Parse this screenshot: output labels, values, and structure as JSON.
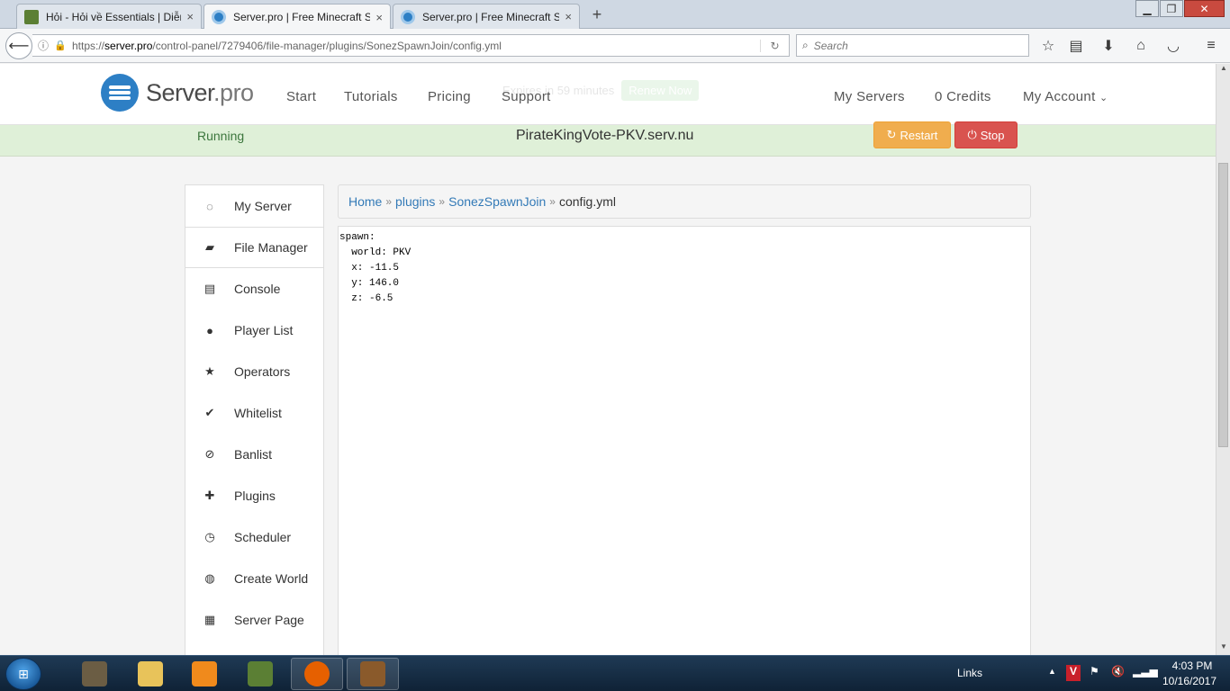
{
  "browser": {
    "tabs": [
      {
        "title": "Hỏi - Hỏi về Essentials | Diễn",
        "close": "×"
      },
      {
        "title": "Server.pro | Free Minecraft Se",
        "close": "×"
      },
      {
        "title": "Server.pro | Free Minecraft Se",
        "close": "×"
      }
    ],
    "new_tab": "+",
    "url_host": "server.pro",
    "url_prefix": "https://",
    "url_path": "/control-panel/7279406/file-manager/plugins/SonezSpawnJoin/config.yml",
    "search_placeholder": "Search"
  },
  "site": {
    "logo_main": "Server",
    "logo_suffix": ".pro",
    "nav": [
      "Start",
      "Tutorials",
      "Pricing",
      "Support"
    ],
    "right_nav": {
      "servers": "My Servers",
      "credits": "0 Credits",
      "account": "My Account"
    },
    "ghost_notice": {
      "text": "Expires in 59 minutes",
      "button": "Renew Now"
    }
  },
  "status": {
    "state": "Running",
    "host": "PirateKingVote-PKV.serv.nu",
    "restart_label": "Restart",
    "stop_label": "Stop"
  },
  "sidebar": {
    "items": [
      {
        "label": "My Server",
        "icon": "circle-notch-icon"
      },
      {
        "label": "File Manager",
        "icon": "folder-open-icon"
      },
      {
        "label": "Console",
        "icon": "list-icon"
      },
      {
        "label": "Player List",
        "icon": "user-icon"
      },
      {
        "label": "Operators",
        "icon": "star-icon"
      },
      {
        "label": "Whitelist",
        "icon": "check-icon"
      },
      {
        "label": "Banlist",
        "icon": "ban-icon"
      },
      {
        "label": "Plugins",
        "icon": "plus-icon"
      },
      {
        "label": "Scheduler",
        "icon": "clock-icon"
      },
      {
        "label": "Create World",
        "icon": "globe-icon"
      },
      {
        "label": "Server Page",
        "icon": "grid-icon"
      }
    ]
  },
  "breadcrumb": {
    "home": "Home",
    "plugins": "plugins",
    "folder": "SonezSpawnJoin",
    "file": "config.yml"
  },
  "editor": {
    "lines": [
      "spawn:",
      "  world: PKV",
      "  x: -11.5",
      "  y: 146.0",
      "  z: -6.5"
    ]
  },
  "taskbar": {
    "links_label": "Links",
    "time": "4:03 PM",
    "date": "10/16/2017"
  },
  "colors": {
    "brand_blue": "#2d7fc5",
    "running_green": "#3c763d",
    "restart_orange": "#f0ad4e",
    "stop_red": "#d9534f",
    "link_blue": "#337ab7"
  }
}
